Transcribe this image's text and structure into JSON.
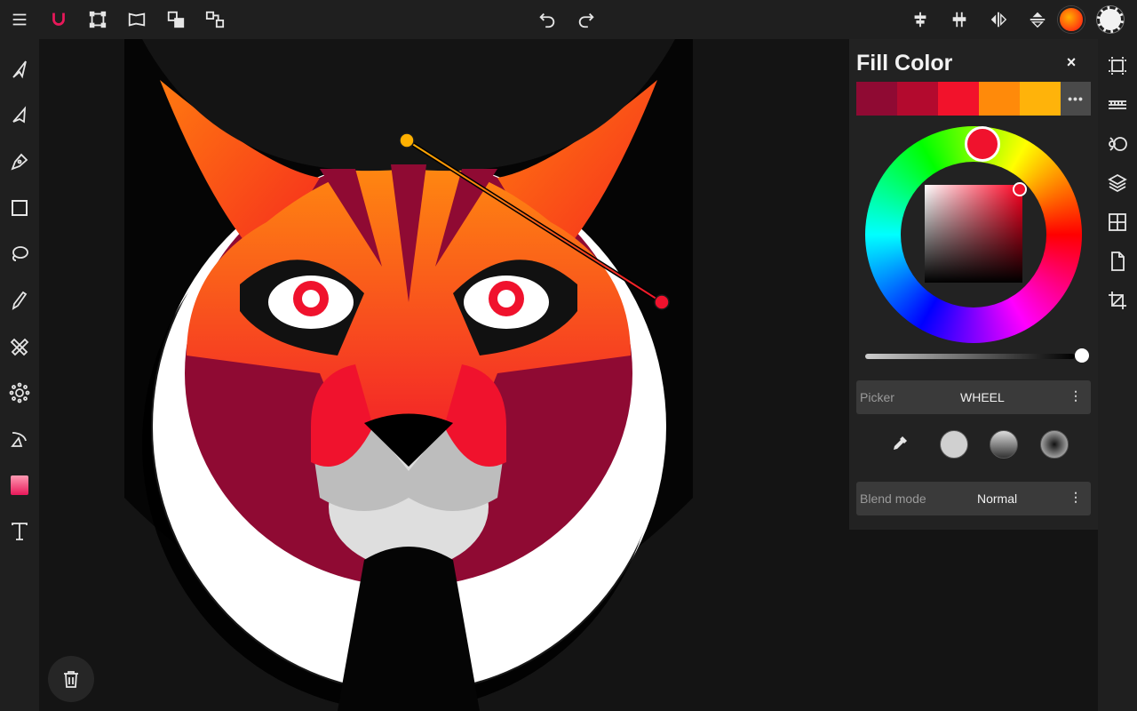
{
  "app": {
    "accent": "#e8185a",
    "background": "#111111"
  },
  "topbar": {
    "left_tools": [
      "menu-icon",
      "magnet-snap-icon",
      "transform-icon",
      "warp-icon",
      "arrange-icon",
      "group-icon"
    ],
    "history": [
      "undo-icon",
      "redo-icon"
    ],
    "right_tools": [
      "align-horizontal-icon",
      "distribute-icon",
      "flip-horizontal-icon",
      "flip-vertical-icon"
    ],
    "fill_swatch_color": "#ff6a10",
    "stroke_swatch_color": "#ffffff"
  },
  "left_tools": [
    "select-arrow-icon",
    "direct-select-icon",
    "pen-icon",
    "rectangle-icon",
    "lasso-icon",
    "pencil-icon",
    "eraser-icon",
    "settings-cog-icon",
    "node-icon",
    "gradient-icon",
    "text-icon"
  ],
  "right_tools": [
    "artboard-icon",
    "grid-icon",
    "styles-icon",
    "layers-icon",
    "symbols-icon",
    "document-icon",
    "crop-icon"
  ],
  "panel": {
    "title": "Fill Color",
    "close": "×",
    "swatches": [
      "#8f0a33",
      "#b30a2e",
      "#f2122b",
      "#ff8a0a",
      "#ffb30a"
    ],
    "more": "•••",
    "current_color": "#f0122d",
    "opacity": 1.0,
    "picker_label": "Picker",
    "picker_value": "WHEEL",
    "blend_label": "Blend mode",
    "blend_value": "Normal",
    "menu_dots": "⋮",
    "fill_types": [
      "eyedropper-icon",
      "solid-fill",
      "linear-gradient",
      "radial-gradient"
    ]
  },
  "bottom": {
    "delete": "trash-icon"
  }
}
